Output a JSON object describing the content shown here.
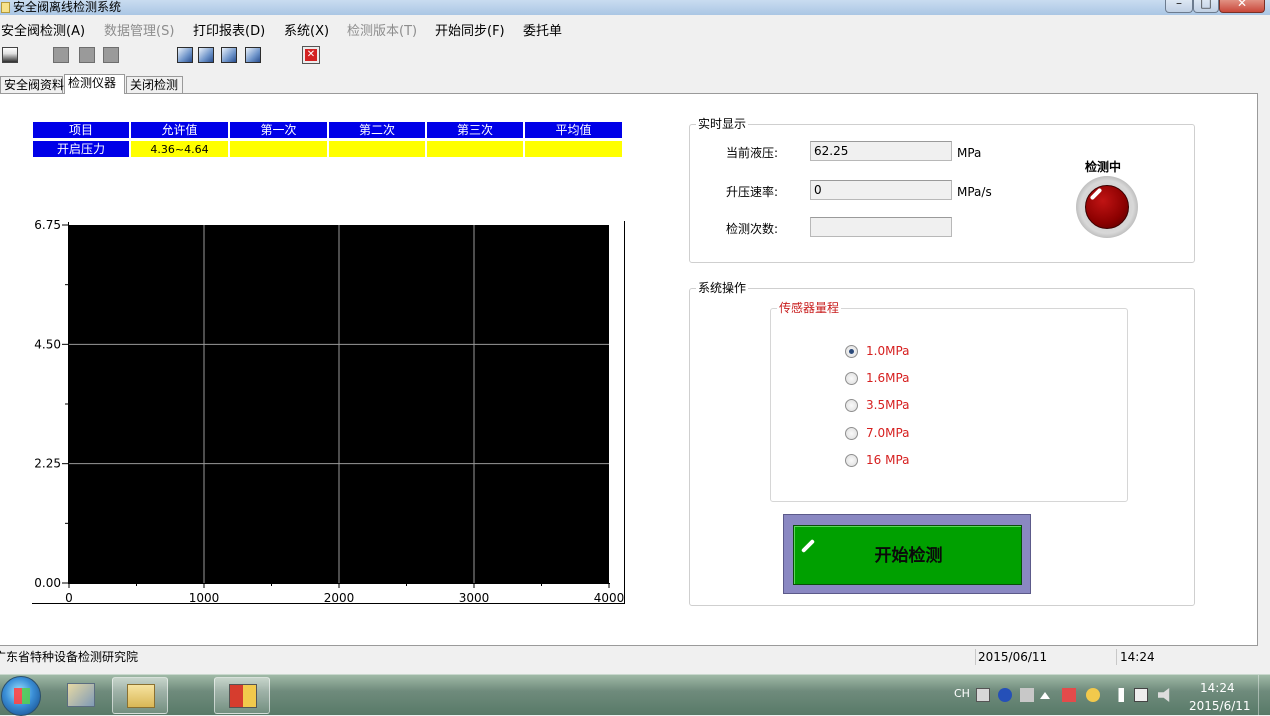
{
  "window": {
    "title": "安全阀离线检测系统",
    "minimize_glyph": "–",
    "maximize_glyph": "□",
    "close_glyph": "✕"
  },
  "menu": [
    {
      "label": "安全阀检测(A)",
      "enabled": true
    },
    {
      "label": "数据管理(S)",
      "enabled": false
    },
    {
      "label": "打印报表(D)",
      "enabled": true
    },
    {
      "label": "系统(X)",
      "enabled": true
    },
    {
      "label": "检测版本(T)",
      "enabled": false
    },
    {
      "label": "开始同步(F)",
      "enabled": true
    },
    {
      "label": "委托单",
      "enabled": true
    }
  ],
  "toolbar": {
    "stop_glyph": "✕",
    "icons": [
      "first-record-icon",
      "gray-icon",
      "gray-icon",
      "gray-icon",
      "image-icon",
      "image-icon",
      "image-icon",
      "image-icon",
      "stop-icon"
    ]
  },
  "tabs": [
    {
      "label": "安全阀资料",
      "active": false
    },
    {
      "label": "检测仪器",
      "active": true
    },
    {
      "label": "关闭检测",
      "active": false
    }
  ],
  "grid": {
    "headers": [
      "项目",
      "允许值",
      "第一次",
      "第二次",
      "第三次",
      "平均值"
    ],
    "rows": [
      [
        "开启压力",
        "4.36~4.64",
        "",
        "",
        "",
        ""
      ]
    ]
  },
  "chart_data": {
    "type": "line",
    "title": "",
    "xlabel": "",
    "ylabel": "",
    "xlim": [
      0,
      4000
    ],
    "ylim": [
      0,
      6.75
    ],
    "x_ticks": [
      "0",
      "1000",
      "2000",
      "3000",
      "4000"
    ],
    "y_ticks": [
      "0.00",
      "2.25",
      "4.50",
      "6.75"
    ],
    "grid": true,
    "background": "#000000",
    "series": []
  },
  "realtime": {
    "title": "实时显示",
    "pressure_label": "当前液压:",
    "pressure_value": "62.25",
    "pressure_unit": "MPa",
    "rate_label": "升压速率:",
    "rate_value": "0",
    "rate_unit": "MPa/s",
    "count_label": "检测次数:",
    "count_value": "",
    "indicator_label": "检测中",
    "indicator_color": "#8b0000"
  },
  "operation": {
    "title": "系统操作",
    "range_title": "传感器量程",
    "ranges": [
      {
        "label": "1.0MPa",
        "selected": true
      },
      {
        "label": "1.6MPa",
        "selected": false
      },
      {
        "label": "3.5MPa",
        "selected": false
      },
      {
        "label": "7.0MPa",
        "selected": false
      },
      {
        "label": "16 MPa",
        "selected": false
      }
    ],
    "start_button": "开始检测",
    "start_color": "#00a000"
  },
  "status": {
    "org": "广东省特种设备检测研究院",
    "date": "2015/06/11",
    "time": "14:24"
  },
  "taskbar": {
    "lang": "CH",
    "clock_time": "14:24",
    "clock_date": "2015/6/11"
  }
}
